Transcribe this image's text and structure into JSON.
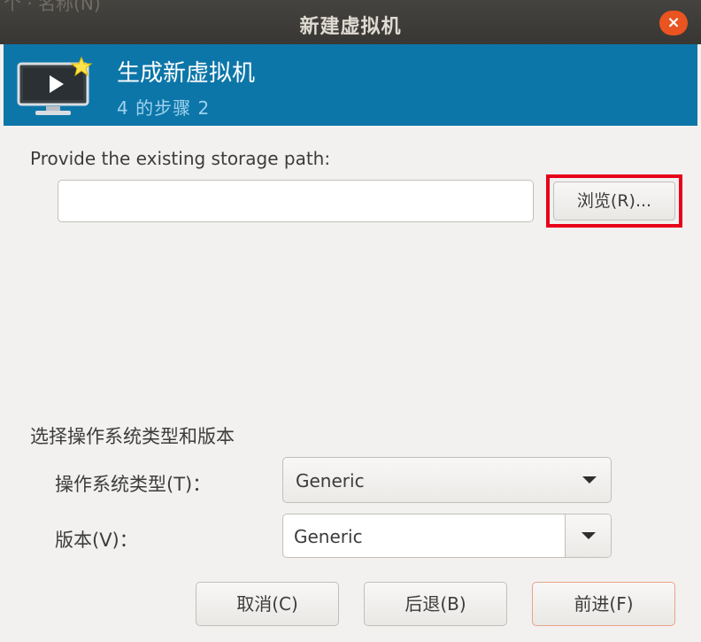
{
  "background": {
    "partial_text": "个 · 名称(N)"
  },
  "window": {
    "title": "新建虚拟机",
    "close_symbol": "×"
  },
  "banner": {
    "title": "生成新虚拟机",
    "subtitle": "4 的步骤 2",
    "icon": "monitor-play-icon",
    "color": "#0d76a9"
  },
  "storage": {
    "label": "Provide the existing storage path:",
    "value": "",
    "browse_label": "浏览(R)..."
  },
  "os": {
    "section_label": "选择操作系统类型和版本",
    "type_label": "操作系统类型(T)：",
    "type_value": "Generic",
    "version_label": "版本(V)：",
    "version_value": "Generic"
  },
  "buttons": {
    "cancel": "取消(C)",
    "back": "后退(B)",
    "forward": "前进(F)"
  },
  "colors": {
    "highlight": "#e8001a",
    "close": "#e95420"
  }
}
